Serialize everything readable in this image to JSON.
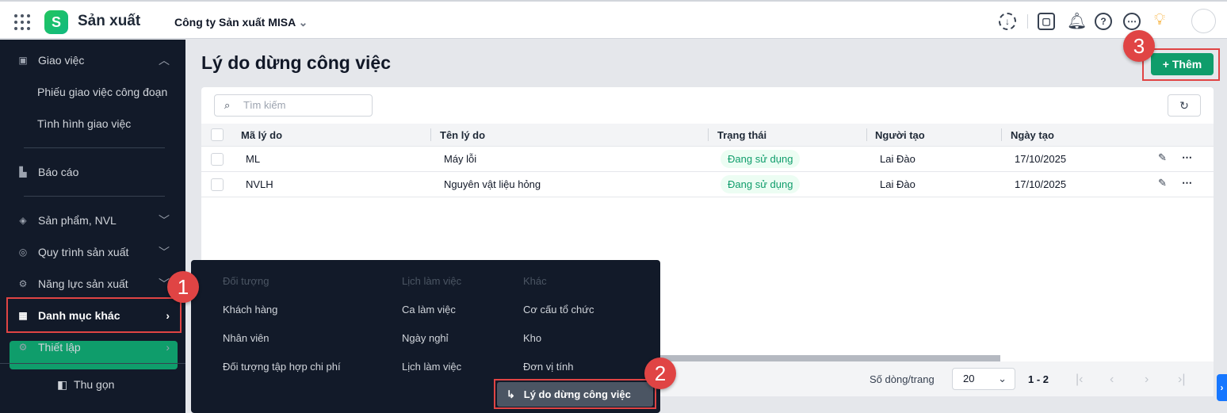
{
  "header": {
    "app_name": "Sản xuất",
    "company": "Công ty Sản xuất MISA"
  },
  "sidebar": {
    "items": [
      {
        "label": "Giao việc"
      },
      {
        "label": "Phiếu giao việc công đoạn"
      },
      {
        "label": "Tình hình giao việc"
      },
      {
        "label": "Báo cáo"
      },
      {
        "label": "Sản phẩm, NVL"
      },
      {
        "label": "Quy trình sản xuất"
      },
      {
        "label": "Năng lực sản xuất"
      },
      {
        "label": "Danh mục khác"
      },
      {
        "label": "Thiết lập"
      }
    ],
    "collapse_label": "Thu gọn"
  },
  "main": {
    "title": "Lý do dừng công việc",
    "add_label": "Thêm",
    "search_placeholder": "Tìm kiếm",
    "columns": [
      "Mã lý do",
      "Tên lý do",
      "Trạng thái",
      "Người tạo",
      "Ngày tạo"
    ],
    "rows": [
      {
        "code": "ML",
        "name": "Máy lỗi",
        "status": "Đang sử dụng",
        "creator": "Lai Đào",
        "date": "17/10/2025"
      },
      {
        "code": "NVLH",
        "name": "Nguyên vật liệu hỏng",
        "status": "Đang sử dụng",
        "creator": "Lai Đào",
        "date": "17/10/2025"
      }
    ],
    "pagination": {
      "rows_label": "Số dòng/trang",
      "page_size": "20",
      "range": "1 - 2"
    }
  },
  "menu": {
    "groups": [
      {
        "title": "Đối tượng",
        "items": [
          "Khách hàng",
          "Nhân viên",
          "Đối tượng tập hợp chi phí"
        ]
      },
      {
        "title": "Lịch làm việc",
        "items": [
          "Ca làm việc",
          "Ngày nghỉ",
          "Lịch làm việc"
        ]
      },
      {
        "title": "Khác",
        "items": [
          "Cơ cấu tổ chức",
          "Kho",
          "Đơn vị tính"
        ]
      }
    ],
    "active_item": "Lý do dừng công việc"
  },
  "markers": [
    "1",
    "2",
    "3"
  ],
  "colors": {
    "accent": "#0f9d6b",
    "sidebar": "#121a29",
    "marker": "#e04444"
  }
}
